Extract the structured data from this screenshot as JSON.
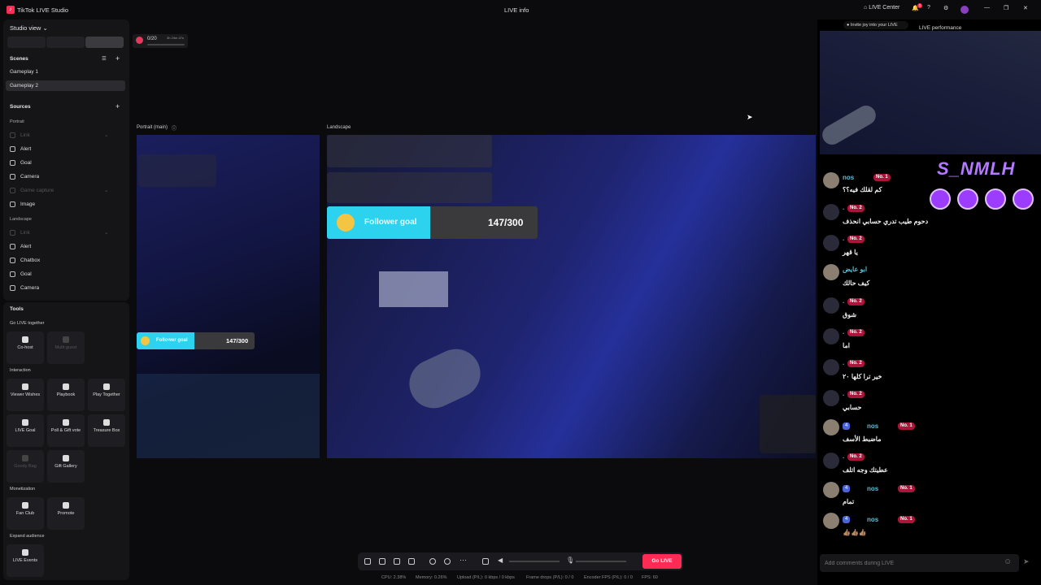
{
  "titlebar": {
    "app_title": "TikTok LIVE Studio",
    "center_title": "LIVE info",
    "live_center": "LIVE Center",
    "notif_count": "1"
  },
  "left": {
    "studio_view": "Studio view",
    "scenes_header": "Scenes",
    "scenes": [
      "Gameplay 1",
      "Gameplay 2"
    ],
    "sources_header": "Sources",
    "portrait_label": "Portrait",
    "portrait_sources": [
      "Link",
      "Alert",
      "Goal",
      "Camera",
      "Game capture",
      "Image"
    ],
    "landscape_label": "Landscape",
    "landscape_sources": [
      "Link",
      "Alert",
      "Chatbox",
      "Goal",
      "Camera"
    ]
  },
  "tools": {
    "header": "Tools",
    "go_live_together": "Go LIVE together",
    "cohost": "Co-host",
    "multiguest": "Multi-guest",
    "interaction": "Interaction",
    "viewer_wishes": "Viewer Wishes",
    "playbook": "Playbook",
    "play_together": "Play Together",
    "live_goal": "LIVE Goal",
    "poll": "Poll & Gift vote",
    "treasure": "Treasure Box",
    "goody": "Goody Bag",
    "gift_gallery": "Gift Gallery",
    "monetization": "Monetization",
    "fan_club": "Fan Club",
    "promote": "Promote",
    "expand": "Expand audience",
    "live_events": "LIVE Events"
  },
  "top_widget": {
    "count": "0/20",
    "timer": "3h 24m 47s"
  },
  "canvas": {
    "portrait_label": "Portrait (main)",
    "landscape_label": "Landscape",
    "goal_title": "Follower goal",
    "goal_value": "147/300",
    "goal_progress": 0.49
  },
  "controls": {
    "go_live": "Go LIVE"
  },
  "stats": {
    "cpu": "CPU: 2.38%",
    "memory": "Memory: 0.26%",
    "upload": "Upload (P/L): 0 kbps / 0 kbps",
    "frame_drops": "Frame drops (P/L): 0 / 0",
    "encoder_fps": "Encoder FPS (P/L): 0 / 0",
    "fps": "FPS: 60"
  },
  "right": {
    "invite": "Invite joy into your LIVE",
    "performance": "LIVE performance",
    "brand": "S_NMLH",
    "comment_placeholder": "Add comments during LIVE"
  },
  "chat": [
    {
      "user": "nos",
      "badge": "No. 1",
      "text": "كم لقلك فيه؟؟"
    },
    {
      "user": ".",
      "badge": "No. 2",
      "text": "دحوم طيب تدري حسابي انحذف"
    },
    {
      "user": ".",
      "badge": "No. 2",
      "text": "يا قهر"
    },
    {
      "user": "ابو عايض",
      "badge": "",
      "text": "كيف حالك"
    },
    {
      "user": ".",
      "badge": "No. 2",
      "text": "شوق"
    },
    {
      "user": ".",
      "badge": "No. 2",
      "text": "اما"
    },
    {
      "user": ".",
      "badge": "No. 2",
      "text": "خير ترا كلها ٢٠"
    },
    {
      "user": ".",
      "badge": "No. 2",
      "text": "حسابي"
    },
    {
      "user": "nos",
      "badge": "No. 1",
      "level": "4",
      "text": "ماضبط الأسف"
    },
    {
      "user": ".",
      "badge": "No. 2",
      "text": "عطيتك وجه اتلف"
    },
    {
      "user": "nos",
      "badge": "No. 1",
      "level": "4",
      "text": "تمام"
    },
    {
      "user": "nos",
      "badge": "No. 1",
      "level": "4",
      "text": "👍🏽👍🏽👍🏽"
    }
  ]
}
